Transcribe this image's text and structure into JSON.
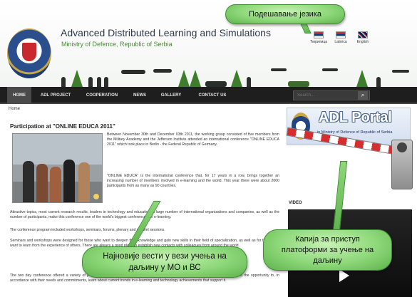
{
  "header": {
    "title": "Advanced Distributed Learning and Simulations",
    "subtitle": "Ministry of Defence, Republic of Serbia"
  },
  "languages": [
    {
      "label": "Ћирилица",
      "flag": "serbia-flag"
    },
    {
      "label": "Latinica",
      "flag": "serbia-flag"
    },
    {
      "label": "English",
      "flag": "uk-flag"
    }
  ],
  "nav": {
    "items": [
      "HOME",
      "ADL PROJECT",
      "COOPERATION",
      "NEWS",
      "GALLERY",
      "CONTACT US"
    ],
    "search_placeholder": "Search...",
    "search_icon": "⌕"
  },
  "breadcrumb": "Home",
  "article": {
    "title": "Participation at \"ONLINE EDUCA 2011\"",
    "p1": "Between November 30th and December 03th 2011, the working group consisted of five members from the Military Academy and the Jefferson Institute attended an international conference \"ONLINE EDUCA 2011\" which took place in Berlin - the Federal Republic of Germany.",
    "p2": "\"ONLINE EDUCA\" is the international conference that, for 17 years in a row, brings together an increasing number of members involved in e-learning and the world. This year there were about 2000 participants from as many as 90 countries.",
    "p3": "Attractive topics, most current research results, leaders in technology and education, a large number of international organizations and companies, as well as the number of participants, make this conference one of the world's biggest conferences on e-learning.",
    "p4": "The conference program included workshops, seminars, forums, plenary and parallel sessions.",
    "p5": "Seminars and workshops were designed for those who want to deepen their knowledge and gain new skills in their field of specialization, as well as for those who want to learn from the experience of others. There are always a good place to establish new contacts with colleagues from around the world.",
    "p6": "The two day conference offered a variety of presentations and panel discussions and poster presentations. Conference participants had the opportunity to, in accordance with their needs and commitments, learn about current trends in e-learning and technology achievements that support it."
  },
  "sidebar": {
    "portal_title": "ADL Portal",
    "portal_subtitle": "in Ministry of Defence of Republic of Serbia",
    "video_label": "VIDEO"
  },
  "callouts": {
    "language": "Подешавање језика",
    "gate_line1": "Капија за приступ",
    "gate_line2": "платоформи за учење на",
    "gate_line3": "даљину",
    "news_line1": "Најновије вести у вези учења на",
    "news_line2": "даљину у МО и ВС"
  },
  "colors": {
    "nav_bg": "#1e1e1e",
    "callout_green": "#8dd879",
    "accent_red": "#d62e2e"
  }
}
